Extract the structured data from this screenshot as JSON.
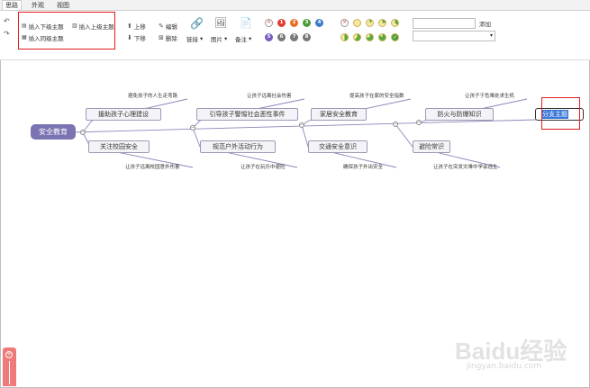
{
  "tabs": [
    {
      "label": "思路"
    },
    {
      "label": "外观"
    },
    {
      "label": "视图"
    }
  ],
  "toolbar": {
    "insert_child": "插入下级主题",
    "insert_parent": "插入上级主题",
    "insert_sibling": "插入同级主题",
    "move_up": "上移",
    "move_down": "下移",
    "edit": "编辑",
    "delete": "删除",
    "link": "链接",
    "image": "图片",
    "note": "备注",
    "add": "添加",
    "priorities": [
      "1",
      "2",
      "3",
      "4",
      "5",
      "6",
      "7",
      "8"
    ],
    "priority_colors": [
      "#e03c31",
      "#e86f28",
      "#4a9d3a",
      "#3b7bc9",
      "#7a5bc2",
      "#777777",
      "#777777",
      "#777777"
    ],
    "progress_levels": [
      0,
      0.125,
      0.25,
      0.375,
      0.5,
      0.625,
      0.75,
      0.875,
      1
    ],
    "tag_input": "",
    "select_value": ""
  },
  "mindmap": {
    "root": "安全教育",
    "top_nodes": [
      "援助孩子心理建设",
      "引导孩子警惕社会恶性事件",
      "家居安全教育",
      "防火与防爆知识"
    ],
    "bottom_nodes": [
      "关注校园安全",
      "规范户外活动行为",
      "交通安全意识",
      "避险常识"
    ],
    "top_labels": [
      "避免孩子的人生走弯路",
      "让孩子远离社会伤害",
      "提高孩子在家的安全指数",
      "让孩子于危难处求生机"
    ],
    "bottom_labels": [
      "让孩子远离校园意外伤害",
      "让孩子在玩乐中避险",
      "确保孩子外出安全",
      "让孩子在突发灾难中学会逃生"
    ],
    "selected_node": "分支主题"
  },
  "watermark": {
    "brand": "Baidu经验",
    "url": "jingyan.baidu.com"
  }
}
